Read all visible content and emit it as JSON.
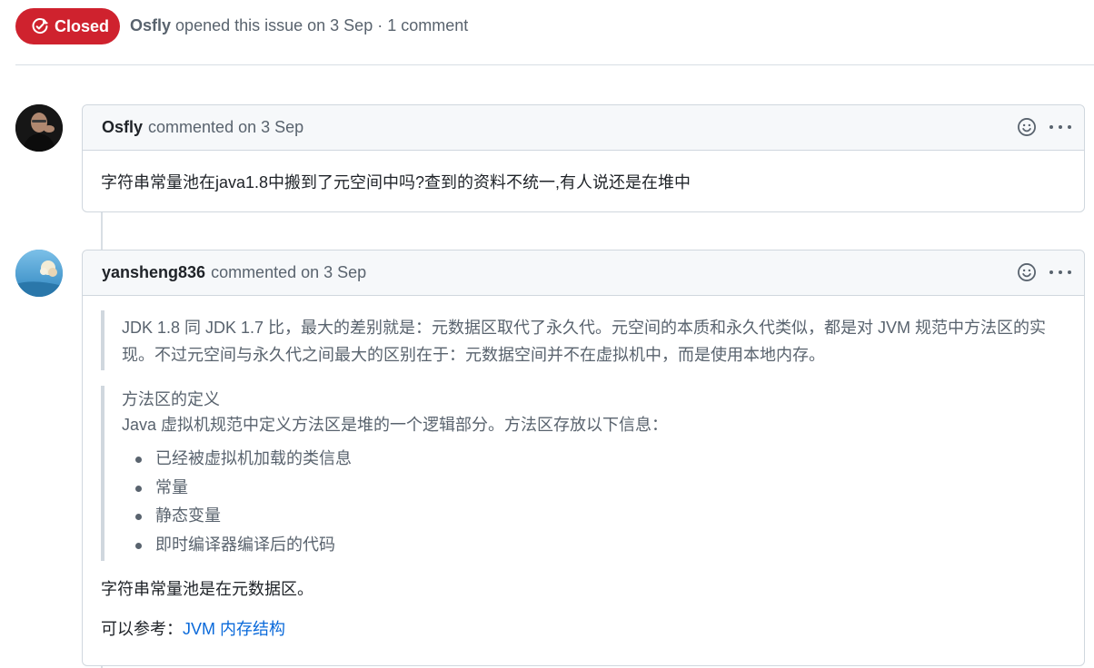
{
  "issue": {
    "state": "Closed",
    "opened_by": "Osfly",
    "opened_text": "opened this issue on 3 Sep · 1 comment"
  },
  "comments": [
    {
      "author": "Osfly",
      "meta": "commented on 3 Sep",
      "body": "字符串常量池在java1.8中搬到了元空间中吗?查到的资料不统一,有人说还是在堆中"
    },
    {
      "author": "yansheng836",
      "meta": "commented on 3 Sep",
      "quote1": "JDK 1.8 同 JDK 1.7 比，最大的差别就是：元数据区取代了永久代。元空间的本质和永久代类似，都是对 JVM 规范中方法区的实现。不过元空间与永久代之间最大的区别在于：元数据空间并不在虚拟机中，而是使用本地内存。",
      "quote2_title": "方法区的定义",
      "quote2_text": "Java 虚拟机规范中定义方法区是堆的一个逻辑部分。方法区存放以下信息：",
      "quote2_items": [
        "已经被虚拟机加载的类信息",
        "常量",
        "静态变量",
        "即时编译器编译后的代码"
      ],
      "para1": "字符串常量池是在元数据区。",
      "para2_prefix": "可以参考：",
      "para2_link": "JVM 内存结构"
    }
  ],
  "icons": {
    "state": "issue-closed-icon",
    "reaction": "smiley-icon",
    "more": "kebab-horizontal-icon"
  },
  "colors": {
    "closed": "#cf222e",
    "link": "#0969da",
    "muted": "#59636e"
  }
}
